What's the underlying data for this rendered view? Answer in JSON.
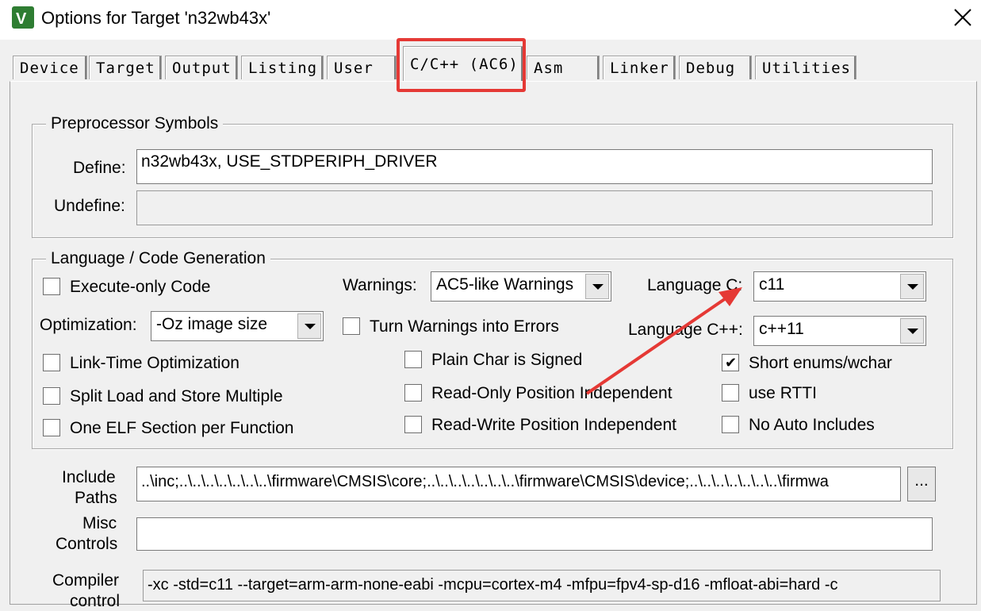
{
  "window": {
    "title": "Options for Target 'n32wb43x'",
    "icon": "keil-uvision-icon"
  },
  "tabs": [
    {
      "label": "Device"
    },
    {
      "label": "Target"
    },
    {
      "label": "Output"
    },
    {
      "label": "Listing"
    },
    {
      "label": "User"
    },
    {
      "label": "C/C++ (AC6)",
      "active": true
    },
    {
      "label": "Asm"
    },
    {
      "label": "Linker"
    },
    {
      "label": "Debug"
    },
    {
      "label": "Utilities"
    }
  ],
  "preprocessor": {
    "group_title": "Preprocessor Symbols",
    "define_label": "Define:",
    "define_value": "n32wb43x, USE_STDPERIPH_DRIVER",
    "undefine_label": "Undefine:",
    "undefine_value": ""
  },
  "codegen": {
    "group_title": "Language / Code Generation",
    "execute_only": {
      "label": "Execute-only Code",
      "checked": false
    },
    "warnings_label": "Warnings:",
    "warnings_value": "AC5-like Warnings",
    "language_c_label": "Language C:",
    "language_c_value": "c11",
    "optimization_label": "Optimization:",
    "optimization_value": "-Oz image size",
    "turn_warnings_errors": {
      "label": "Turn Warnings into Errors",
      "checked": false
    },
    "language_cpp_label": "Language C++:",
    "language_cpp_value": "c++11",
    "link_time_opt": {
      "label": "Link-Time Optimization",
      "checked": false
    },
    "plain_char_signed": {
      "label": "Plain Char is Signed",
      "checked": false
    },
    "short_enums": {
      "label": "Short enums/wchar",
      "checked": true
    },
    "split_load_store": {
      "label": "Split Load and Store Multiple",
      "checked": false
    },
    "ropi": {
      "label": "Read-Only Position Independent",
      "checked": false
    },
    "use_rtti": {
      "label": "use RTTI",
      "checked": false
    },
    "one_elf_section": {
      "label": "One ELF Section per Function",
      "checked": false
    },
    "rwpi": {
      "label": "Read-Write Position Independent",
      "checked": false
    },
    "no_auto_includes": {
      "label": "No Auto Includes",
      "checked": false
    }
  },
  "include_paths": {
    "label_line1": "Include",
    "label_line2": "Paths",
    "value": "..\\inc;..\\..\\..\\..\\..\\..\\..\\firmware\\CMSIS\\core;..\\..\\..\\..\\..\\..\\..\\firmware\\CMSIS\\device;..\\..\\..\\..\\..\\..\\..\\firmwa",
    "browse_label": "..."
  },
  "misc_controls": {
    "label_line1": "Misc",
    "label_line2": "Controls",
    "value": ""
  },
  "compiler_control": {
    "label_line1": "Compiler",
    "label_line2": "control",
    "value": "-xc -std=c11 --target=arm-arm-none-eabi -mcpu=cortex-m4 -mfpu=fpv4-sp-d16 -mfloat-abi=hard -c"
  },
  "annotation_color": "#e53935"
}
